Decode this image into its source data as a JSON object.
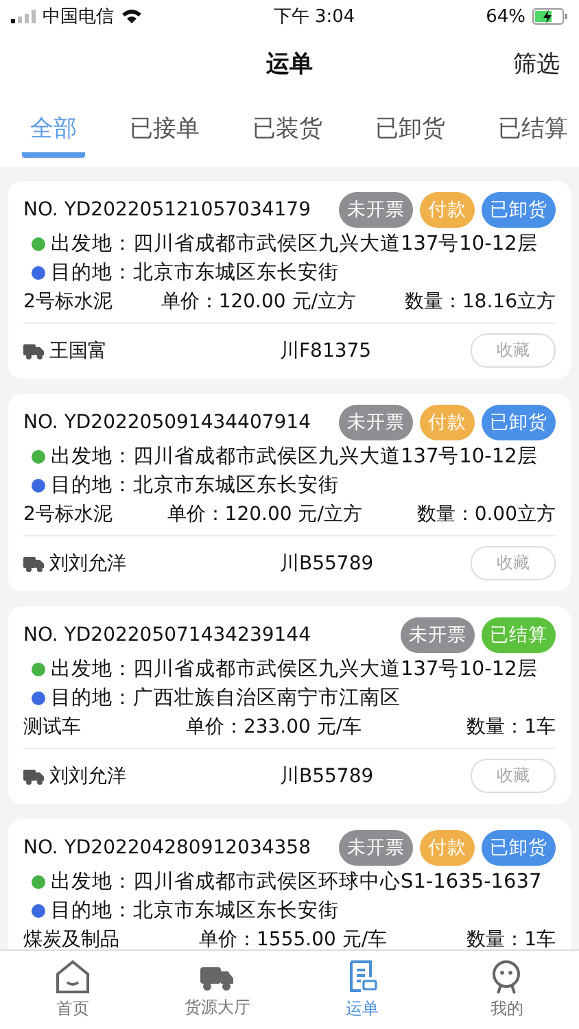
{
  "status_bar": {
    "carrier": "中国电信",
    "time": "下午 3:04",
    "battery": "64%"
  },
  "header": {
    "title": "运单",
    "action": "筛选"
  },
  "tabs": [
    {
      "label": "全部",
      "selected": true
    },
    {
      "label": "已接单",
      "selected": false
    },
    {
      "label": "已装货",
      "selected": false
    },
    {
      "label": "已卸货",
      "selected": false
    },
    {
      "label": "已结算",
      "selected": false
    }
  ],
  "orders": [
    {
      "number": "NO. YD202205121057034179",
      "badges": [
        {
          "label": "未开票",
          "color": "#8e8e93"
        },
        {
          "label": "付款",
          "color": "#f0b04a"
        },
        {
          "label": "已卸货",
          "color": "#4a90e8"
        }
      ],
      "origin": {
        "label": "出发地：",
        "value": "四川省成都市武侯区九兴大道137号10-12层"
      },
      "destination": {
        "label": "目的地：",
        "value": "北京市东城区东长安街"
      },
      "goods": "2号标水泥",
      "price": "单价：120.00 元/立方",
      "quantity": "数量：18.16立方",
      "driver": "王国富",
      "plate": "川F81375",
      "favorite": "收藏"
    },
    {
      "number": "NO. YD202205091434407914",
      "badges": [
        {
          "label": "未开票",
          "color": "#8e8e93"
        },
        {
          "label": "付款",
          "color": "#f0b04a"
        },
        {
          "label": "已卸货",
          "color": "#4a90e8"
        }
      ],
      "origin": {
        "label": "出发地：",
        "value": "四川省成都市武侯区九兴大道137号10-12层"
      },
      "destination": {
        "label": "目的地：",
        "value": "北京市东城区东长安街"
      },
      "goods": "2号标水泥",
      "price": "单价：120.00 元/立方",
      "quantity": "数量：0.00立方",
      "driver": "刘刘允洋",
      "plate": "川B55789",
      "favorite": "收藏"
    },
    {
      "number": "NO. YD202205071434239144",
      "badges": [
        {
          "label": "未开票",
          "color": "#8e8e93"
        },
        {
          "label": "已结算",
          "color": "#5cc13c"
        }
      ],
      "origin": {
        "label": "出发地：",
        "value": "四川省成都市武侯区九兴大道137号10-12层"
      },
      "destination": {
        "label": "目的地：",
        "value": "广西壮族自治区南宁市江南区"
      },
      "goods": "测试车",
      "price": "单价：233.00 元/车",
      "quantity": "数量：1车",
      "driver": "刘刘允洋",
      "plate": "川B55789",
      "favorite": "收藏"
    },
    {
      "number": "NO. YD202204280912034358",
      "badges": [
        {
          "label": "未开票",
          "color": "#8e8e93"
        },
        {
          "label": "付款",
          "color": "#f0b04a"
        },
        {
          "label": "已卸货",
          "color": "#4a90e8"
        }
      ],
      "origin": {
        "label": "出发地：",
        "value": "四川省成都市武侯区环球中心S1-1635-1637"
      },
      "destination": {
        "label": "目的地：",
        "value": "北京市东城区东长安街"
      },
      "goods": "煤炭及制品",
      "price": "单价：1555.00 元/车",
      "quantity": "数量：1车"
    }
  ],
  "tab_bar": [
    {
      "label": "首页",
      "kind": "home",
      "selected": false
    },
    {
      "label": "货源大厅",
      "kind": "truck",
      "selected": false
    },
    {
      "label": "运单",
      "kind": "orders",
      "selected": true
    },
    {
      "label": "我的",
      "kind": "profile",
      "selected": false
    }
  ]
}
